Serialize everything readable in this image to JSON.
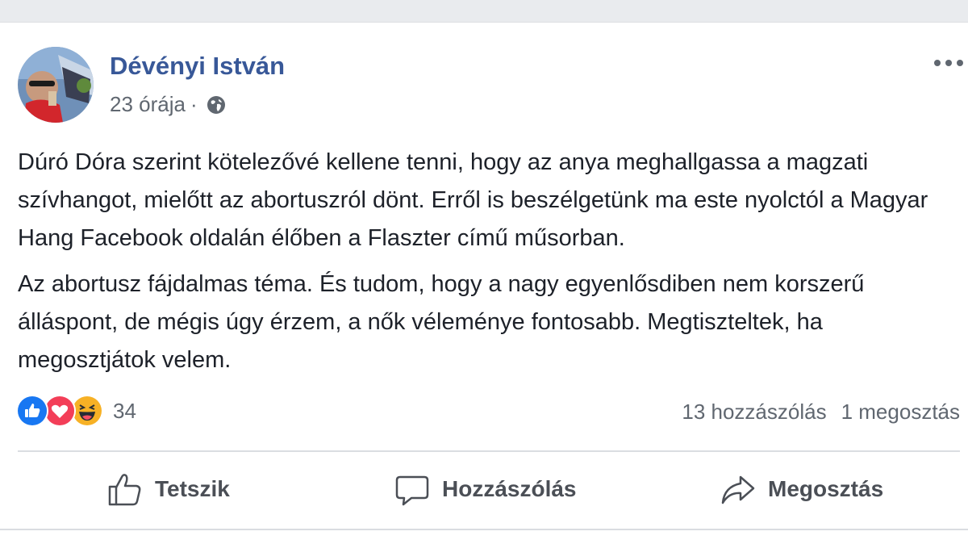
{
  "post": {
    "author": "Dévényi István",
    "time": "23 órája",
    "separator": "·",
    "privacy_icon": "globe-icon",
    "more_icon": "more-options-icon",
    "paragraphs": [
      "Dúró Dóra szerint kötelezővé kellene tenni, hogy az anya meghallgassa a magzati szívhangot, mielőtt az abortuszról dönt. Erről is beszélgetünk ma este nyolctól a Magyar Hang Facebook oldalán élőben a Flaszter című műsorban.",
      "Az abortusz fájdalmas téma. És tudom, hogy a nagy egyenlősdiben nem korszerű álláspont, de mégis úgy érzem, a nők véleménye fontosabb. Megtiszteltek, ha megosztjátok velem."
    ]
  },
  "reactions": {
    "icons": [
      "like-reaction-icon",
      "love-reaction-icon",
      "haha-reaction-icon"
    ],
    "count": "34",
    "comments": "13 hozzászólás",
    "shares": "1 megosztás"
  },
  "actions": {
    "like_label": "Tetszik",
    "comment_label": "Hozzászólás",
    "share_label": "Megosztás"
  },
  "colors": {
    "author": "#385898",
    "like_blue": "#1877f2",
    "love_red": "#f33e58",
    "haha_yellow": "#f7b125",
    "secondary_text": "#606770",
    "action_text": "#4b4f56"
  }
}
